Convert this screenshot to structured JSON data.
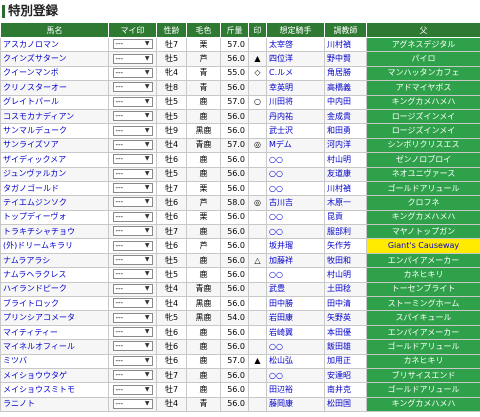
{
  "page_title": "特別登録",
  "headers": [
    "馬名",
    "マイ印",
    "性齢",
    "毛色",
    "斤量",
    "印",
    "想定騎手",
    "調教師",
    "父"
  ],
  "select_default": "---",
  "rows": [
    {
      "name": "アスカノロマン",
      "sex_age": "牡7",
      "color": "栗",
      "weight": "57.0",
      "mark": "",
      "jockey": "太宰啓",
      "trainer": "川村禎",
      "sire": "アグネスデジタル",
      "sire_ext": false
    },
    {
      "name": "クインズサターン",
      "sex_age": "牡5",
      "color": "芦",
      "weight": "56.0",
      "mark": "▲",
      "jockey": "四位洋",
      "trainer": "野中賢",
      "sire": "パイロ",
      "sire_ext": false
    },
    {
      "name": "クイーンマンボ",
      "sex_age": "牝4",
      "color": "青",
      "weight": "55.0",
      "mark": "◇",
      "jockey": "C.ルメ",
      "trainer": "角居勝",
      "sire": "マンハッタンカフェ",
      "sire_ext": false
    },
    {
      "name": "クリノスターオー",
      "sex_age": "牡8",
      "color": "青",
      "weight": "56.0",
      "mark": "",
      "jockey": "幸英明",
      "trainer": "高橋義",
      "sire": "アドマイヤボス",
      "sire_ext": false
    },
    {
      "name": "グレイトパール",
      "sex_age": "牡5",
      "color": "鹿",
      "weight": "57.0",
      "mark": "○",
      "jockey": "川田将",
      "trainer": "中内田",
      "sire": "キングカメハメハ",
      "sire_ext": false
    },
    {
      "name": "コスモカナディアン",
      "sex_age": "牡5",
      "color": "鹿",
      "weight": "56.0",
      "mark": "",
      "jockey": "丹内祐",
      "trainer": "金成貴",
      "sire": "ロージズインメイ",
      "sire_ext": false
    },
    {
      "name": "サンマルデューク",
      "sex_age": "牡9",
      "color": "黒鹿",
      "weight": "56.0",
      "mark": "",
      "jockey": "武士沢",
      "trainer": "和田勇",
      "sire": "ロージズインメイ",
      "sire_ext": false
    },
    {
      "name": "サンライズソア",
      "sex_age": "牡4",
      "color": "青鹿",
      "weight": "57.0",
      "mark": "◎",
      "jockey": "Mデム",
      "trainer": "河内洋",
      "sire": "シンボリクリスエス",
      "sire_ext": false
    },
    {
      "name": "ザイディックメア",
      "sex_age": "牡6",
      "color": "鹿",
      "weight": "56.0",
      "mark": "",
      "jockey": "○○",
      "trainer": "村山明",
      "sire": "ゼンノロブロイ",
      "sire_ext": false
    },
    {
      "name": "ジュンヴァルカン",
      "sex_age": "牡5",
      "color": "鹿",
      "weight": "56.0",
      "mark": "",
      "jockey": "○○",
      "trainer": "友道康",
      "sire": "ネオユニヴァース",
      "sire_ext": false
    },
    {
      "name": "タガノゴールド",
      "sex_age": "牡7",
      "color": "栗",
      "weight": "56.0",
      "mark": "",
      "jockey": "○○",
      "trainer": "川村禎",
      "sire": "ゴールドアリュール",
      "sire_ext": false
    },
    {
      "name": "テイエムジンソク",
      "sex_age": "牡6",
      "color": "芦",
      "weight": "58.0",
      "mark": "◎",
      "jockey": "古川吉",
      "trainer": "木原一",
      "sire": "クロフネ",
      "sire_ext": false
    },
    {
      "name": "トップディーヴォ",
      "sex_age": "牡6",
      "color": "栗",
      "weight": "56.0",
      "mark": "",
      "jockey": "○○",
      "trainer": "昆貢",
      "sire": "キングカメハメハ",
      "sire_ext": false
    },
    {
      "name": "トラキチシャチョウ",
      "sex_age": "牡7",
      "color": "鹿",
      "weight": "56.0",
      "mark": "",
      "jockey": "○○",
      "trainer": "服部利",
      "sire": "マヤノトップガン",
      "sire_ext": false
    },
    {
      "name": "(外)ドリームキラリ",
      "sex_age": "牡6",
      "color": "芦",
      "weight": "56.0",
      "mark": "",
      "jockey": "坂井瑠",
      "trainer": "矢作芳",
      "sire": "Giant's Causeway",
      "sire_ext": true
    },
    {
      "name": "ナムラアラシ",
      "sex_age": "牡5",
      "color": "鹿",
      "weight": "56.0",
      "mark": "△",
      "jockey": "加藤祥",
      "trainer": "牧田和",
      "sire": "エンパイアメーカー",
      "sire_ext": false
    },
    {
      "name": "ナムラヘラクレス",
      "sex_age": "牡5",
      "color": "鹿",
      "weight": "56.0",
      "mark": "",
      "jockey": "○○",
      "trainer": "村山明",
      "sire": "カネヒキリ",
      "sire_ext": false
    },
    {
      "name": "ハイランドピーク",
      "sex_age": "牡4",
      "color": "青鹿",
      "weight": "56.0",
      "mark": "",
      "jockey": "武豊",
      "trainer": "土田稔",
      "sire": "トーセンブライト",
      "sire_ext": false
    },
    {
      "name": "ブライトロック",
      "sex_age": "牡4",
      "color": "黒鹿",
      "weight": "56.0",
      "mark": "",
      "jockey": "田中勝",
      "trainer": "田中清",
      "sire": "ストーミングホーム",
      "sire_ext": false
    },
    {
      "name": "プリンシアコメータ",
      "sex_age": "牝5",
      "color": "黒鹿",
      "weight": "54.0",
      "mark": "",
      "jockey": "岩田康",
      "trainer": "矢野英",
      "sire": "スパイキュール",
      "sire_ext": false
    },
    {
      "name": "マイティティー",
      "sex_age": "牡6",
      "color": "鹿",
      "weight": "56.0",
      "mark": "",
      "jockey": "岩崎翼",
      "trainer": "本田優",
      "sire": "エンパイアメーカー",
      "sire_ext": false
    },
    {
      "name": "マイネルオフィール",
      "sex_age": "牡6",
      "color": "鹿",
      "weight": "56.0",
      "mark": "",
      "jockey": "○○",
      "trainer": "飯田雄",
      "sire": "ゴールドアリュール",
      "sire_ext": false
    },
    {
      "name": "ミツバ",
      "sex_age": "牡6",
      "color": "鹿",
      "weight": "57.0",
      "mark": "▲",
      "jockey": "松山弘",
      "trainer": "加用正",
      "sire": "カネヒキリ",
      "sire_ext": false
    },
    {
      "name": "メイショウウタゲ",
      "sex_age": "牡7",
      "color": "鹿",
      "weight": "56.0",
      "mark": "",
      "jockey": "○○",
      "trainer": "安達昭",
      "sire": "ブリサイスエンド",
      "sire_ext": false
    },
    {
      "name": "メイショウスミトモ",
      "sex_age": "牡7",
      "color": "鹿",
      "weight": "56.0",
      "mark": "",
      "jockey": "田辺裕",
      "trainer": "南井克",
      "sire": "ゴールドアリュール",
      "sire_ext": false
    },
    {
      "name": "ラニノト",
      "sex_age": "牡4",
      "color": "青",
      "weight": "56.0",
      "mark": "",
      "jockey": "藤岡康",
      "trainer": "松田国",
      "sire": "キングカメハメハ",
      "sire_ext": false
    }
  ]
}
